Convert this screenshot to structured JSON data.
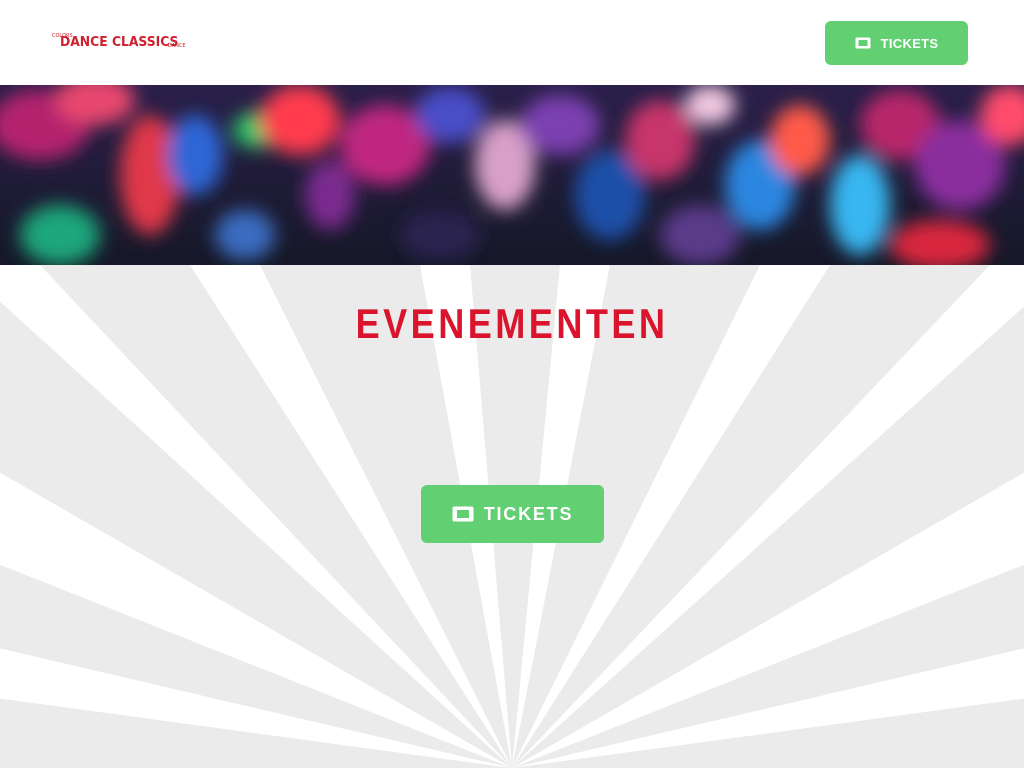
{
  "header": {
    "logo": {
      "top_small": "COLORS",
      "main": "DANCE CLASSICS",
      "bottom_small": "DANCE"
    },
    "tickets_button_label": "TICKETS"
  },
  "hero": {
    "image": "crowd-dancing-photo"
  },
  "main": {
    "title": "EVENEMENTEN",
    "tickets_button_label": "TICKETS"
  },
  "icons": {
    "ticket": "ticket-icon"
  },
  "colors": {
    "accent_red": "#d9142c",
    "button_green": "#63cf73",
    "ray_gray": "#ebebeb",
    "background": "#ffffff"
  }
}
